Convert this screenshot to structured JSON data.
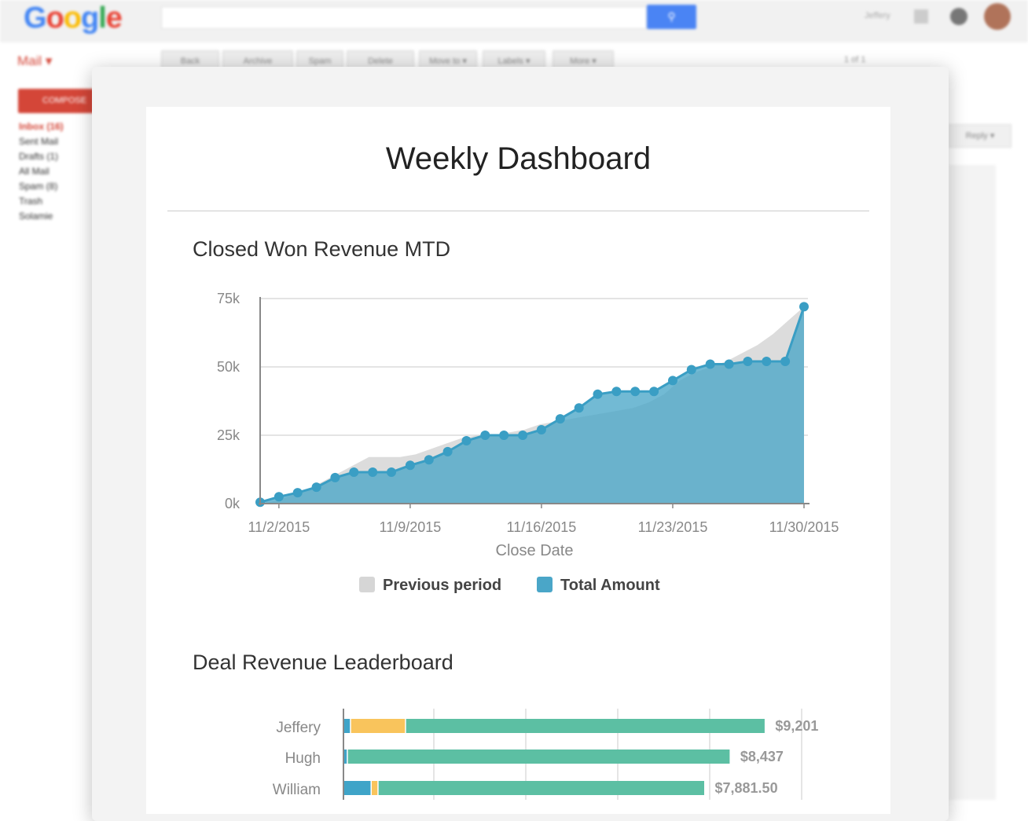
{
  "gmail": {
    "logo_letters": [
      {
        "ch": "G",
        "color": "#4285f4"
      },
      {
        "ch": "o",
        "color": "#ea4335"
      },
      {
        "ch": "o",
        "color": "#fbbc05"
      },
      {
        "ch": "g",
        "color": "#4285f4"
      },
      {
        "ch": "l",
        "color": "#34a853"
      },
      {
        "ch": "e",
        "color": "#ea4335"
      }
    ],
    "search_icon": "search-icon",
    "user": "Jeffery",
    "mail_label": "Mail ▾",
    "toolbar": [
      "Back",
      "Archive",
      "Spam",
      "Delete",
      "Move to ▾",
      "Labels ▾",
      "More ▾"
    ],
    "compose": "COMPOSE",
    "folders": [
      "Inbox (16)",
      "Sent Mail",
      "Drafts (1)",
      "All Mail",
      "Spam (8)",
      "Trash",
      "Solamie"
    ],
    "pager": "1 of 1",
    "reply_all": "Reply ▾"
  },
  "dashboard": {
    "title": "Weekly Dashboard",
    "line_section_title": "Closed Won Revenue MTD",
    "bar_section_title": "Deal Revenue Leaderboard"
  },
  "chart_data": [
    {
      "type": "area",
      "title": "Closed Won Revenue MTD",
      "xlabel": "Close Date",
      "ylabel": "",
      "ylim": [
        0,
        75000
      ],
      "yticks": [
        "0k",
        "25k",
        "50k",
        "75k"
      ],
      "xticks": [
        "11/2/2015",
        "11/9/2015",
        "11/16/2015",
        "11/23/2015",
        "11/30/2015"
      ],
      "legend": {
        "placement": "bottom"
      },
      "series": [
        {
          "name": "Previous period",
          "color": "#d6d6d6",
          "values": [
            0,
            1000,
            3000,
            5000,
            8000,
            11000,
            14000,
            17000,
            17000,
            17000,
            18000,
            20000,
            22000,
            24000,
            25000,
            25000,
            26000,
            27000,
            29000,
            30000,
            31000,
            32000,
            33000,
            34000,
            35000,
            37000,
            40000,
            45000,
            48000,
            50000,
            52000,
            55000,
            58000,
            62000,
            67000,
            72000
          ]
        },
        {
          "name": "Total Amount",
          "color": "#4aa6c8",
          "x": [
            "11/1/2015",
            "11/2/2015",
            "11/3/2015",
            "11/4/2015",
            "11/5/2015",
            "11/6/2015",
            "11/7/2015",
            "11/8/2015",
            "11/9/2015",
            "11/10/2015",
            "11/11/2015",
            "11/12/2015",
            "11/13/2015",
            "11/14/2015",
            "11/15/2015",
            "11/16/2015",
            "11/17/2015",
            "11/18/2015",
            "11/19/2015",
            "11/20/2015",
            "11/21/2015",
            "11/22/2015",
            "11/23/2015",
            "11/24/2015",
            "11/25/2015",
            "11/26/2015",
            "11/27/2015",
            "11/28/2015",
            "11/29/2015",
            "11/30/2015"
          ],
          "values": [
            500,
            2500,
            4000,
            6000,
            9500,
            11500,
            11500,
            11500,
            14000,
            16000,
            19000,
            23000,
            25000,
            25000,
            25000,
            27000,
            31000,
            35000,
            40000,
            41000,
            41000,
            41000,
            45000,
            49000,
            51000,
            51000,
            52000,
            52000,
            52000,
            72000
          ]
        }
      ]
    },
    {
      "type": "bar",
      "orientation": "horizontal",
      "stacked": true,
      "title": "Deal Revenue Leaderboard",
      "categories": [
        "Jeffery",
        "Hugh",
        "William"
      ],
      "totals": [
        "$9,201",
        "$8,437",
        "$7,881.50"
      ],
      "series": [
        {
          "name": "",
          "color": "#3fa4c8",
          "values": [
            150,
            80,
            600
          ]
        },
        {
          "name": "",
          "color": "#f9c45c",
          "values": [
            1200,
            0,
            150
          ]
        },
        {
          "name": "",
          "color": "#5cbfa3",
          "values": [
            7851,
            8357,
            7131.5
          ]
        }
      ],
      "xlim": [
        0,
        10000
      ]
    }
  ]
}
